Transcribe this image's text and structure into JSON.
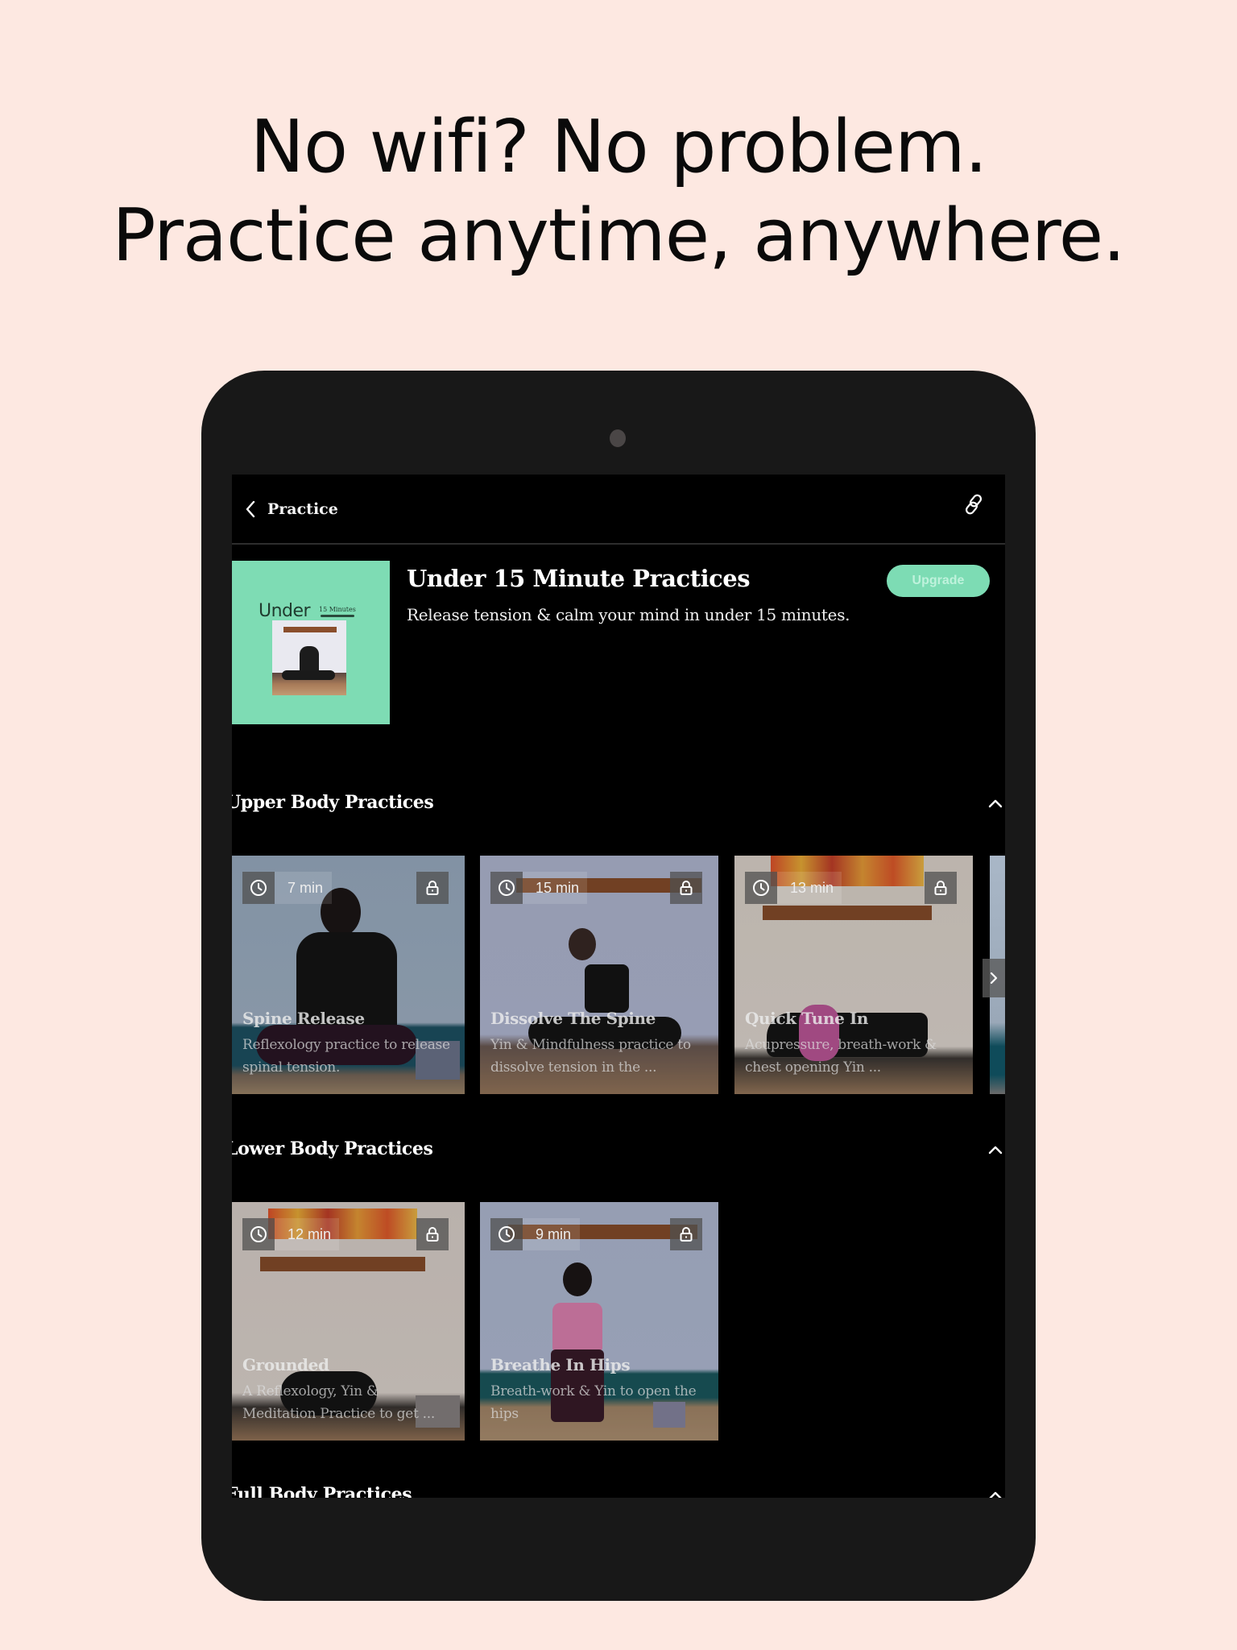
{
  "headline": {
    "line1": "No wifi? No problem.",
    "line2": "Practice anytime, anywhere."
  },
  "colors": {
    "background": "#fde8e1",
    "accent": "#7ddcb4",
    "device": "#181818",
    "screen": "#000000"
  },
  "navbar": {
    "back_label": "Practice",
    "back_icon": "chevron-left-icon",
    "share_icon": "link-icon"
  },
  "collection": {
    "cover": {
      "title_large": "Under",
      "title_small": "15 Minutes"
    },
    "title": "Under 15 Minute Practices",
    "description": "Release tension & calm your mind in under 15 minutes.",
    "upgrade_label": "Upgrade"
  },
  "sections": [
    {
      "title": "Upper Body Practices",
      "toggle_icon": "chevron-up-icon",
      "items": [
        {
          "duration": "7 min",
          "title": "Spine Release",
          "description": "Reflexology practice to release spinal tension.",
          "locked": true
        },
        {
          "duration": "15 min",
          "title": "Dissolve The Spine",
          "description": "Yin & Mindfulness practice to dissolve tension in the ...",
          "locked": true
        },
        {
          "duration": "13 min",
          "title": "Quick Tune In",
          "description": "Acupressure, breath-work & chest opening Yin ...",
          "locked": true
        }
      ],
      "next_icon": "chevron-right-icon"
    },
    {
      "title": "Lower Body Practices",
      "toggle_icon": "chevron-up-icon",
      "items": [
        {
          "duration": "12 min",
          "title": "Grounded",
          "description": "A Reflexology, Yin & Meditation Practice to get ...",
          "locked": true
        },
        {
          "duration": "9 min",
          "title": "Breathe In Hips",
          "description": "Breath-work & Yin to open the hips",
          "locked": true
        }
      ]
    },
    {
      "title": "Full Body Practices",
      "toggle_icon": "chevron-up-icon",
      "items": []
    }
  ]
}
